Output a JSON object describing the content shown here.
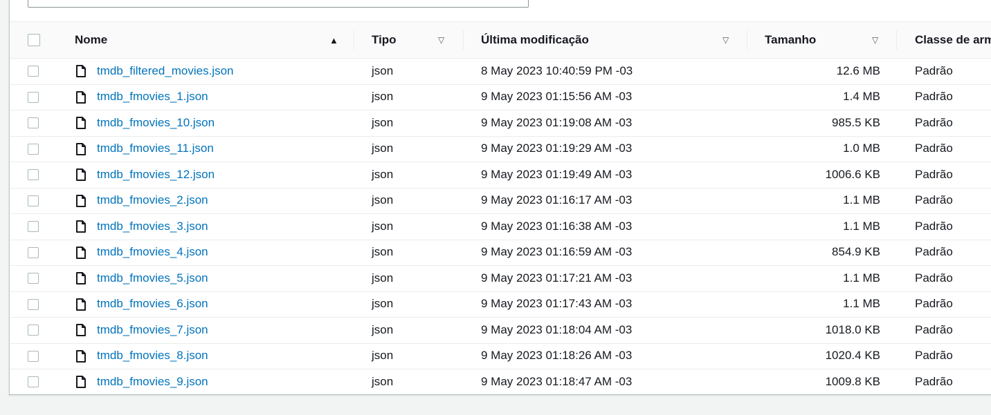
{
  "table": {
    "columns": {
      "name": "Nome",
      "type": "Tipo",
      "modified": "Última modificação",
      "size": "Tamanho",
      "storage_class": "Classe de arm"
    },
    "rows": [
      {
        "name": "tmdb_filtered_movies.json",
        "type": "json",
        "modified": "8 May 2023 10:40:59 PM -03",
        "size": "12.6 MB",
        "storage_class": "Padrão"
      },
      {
        "name": "tmdb_fmovies_1.json",
        "type": "json",
        "modified": "9 May 2023 01:15:56 AM -03",
        "size": "1.4 MB",
        "storage_class": "Padrão"
      },
      {
        "name": "tmdb_fmovies_10.json",
        "type": "json",
        "modified": "9 May 2023 01:19:08 AM -03",
        "size": "985.5 KB",
        "storage_class": "Padrão"
      },
      {
        "name": "tmdb_fmovies_11.json",
        "type": "json",
        "modified": "9 May 2023 01:19:29 AM -03",
        "size": "1.0 MB",
        "storage_class": "Padrão"
      },
      {
        "name": "tmdb_fmovies_12.json",
        "type": "json",
        "modified": "9 May 2023 01:19:49 AM -03",
        "size": "1006.6 KB",
        "storage_class": "Padrão"
      },
      {
        "name": "tmdb_fmovies_2.json",
        "type": "json",
        "modified": "9 May 2023 01:16:17 AM -03",
        "size": "1.1 MB",
        "storage_class": "Padrão"
      },
      {
        "name": "tmdb_fmovies_3.json",
        "type": "json",
        "modified": "9 May 2023 01:16:38 AM -03",
        "size": "1.1 MB",
        "storage_class": "Padrão"
      },
      {
        "name": "tmdb_fmovies_4.json",
        "type": "json",
        "modified": "9 May 2023 01:16:59 AM -03",
        "size": "854.9 KB",
        "storage_class": "Padrão"
      },
      {
        "name": "tmdb_fmovies_5.json",
        "type": "json",
        "modified": "9 May 2023 01:17:21 AM -03",
        "size": "1.1 MB",
        "storage_class": "Padrão"
      },
      {
        "name": "tmdb_fmovies_6.json",
        "type": "json",
        "modified": "9 May 2023 01:17:43 AM -03",
        "size": "1.1 MB",
        "storage_class": "Padrão"
      },
      {
        "name": "tmdb_fmovies_7.json",
        "type": "json",
        "modified": "9 May 2023 01:18:04 AM -03",
        "size": "1018.0 KB",
        "storage_class": "Padrão"
      },
      {
        "name": "tmdb_fmovies_8.json",
        "type": "json",
        "modified": "9 May 2023 01:18:26 AM -03",
        "size": "1020.4 KB",
        "storage_class": "Padrão"
      },
      {
        "name": "tmdb_fmovies_9.json",
        "type": "json",
        "modified": "9 May 2023 01:18:47 AM -03",
        "size": "1009.8 KB",
        "storage_class": "Padrão"
      }
    ]
  },
  "icons": {
    "sort_ascending": "triangle-up-icon",
    "sort_unsorted": "triangle-down-outline-icon",
    "file": "file-icon"
  },
  "colors": {
    "link": "#0073bb",
    "text": "#16191f",
    "background": "#f2f3f3"
  }
}
